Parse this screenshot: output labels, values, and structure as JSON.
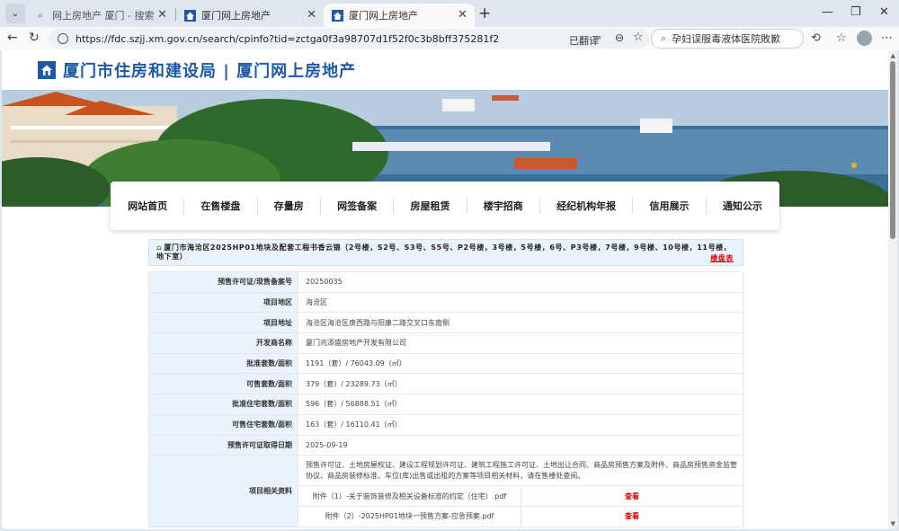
{
  "browser": {
    "tabs": [
      {
        "title": "网上房地产 厦门 - 搜索",
        "active": false
      },
      {
        "title": "厦门网上房地产",
        "active": false
      },
      {
        "title": "厦门网上房地产",
        "active": true
      }
    ],
    "url": "https://fdc.szjj.xm.gov.cn/search/cpinfo?tid=zctga0f3a98707d1f52f0c3b8bff375281f2",
    "translate_label": "已翻译",
    "search_query": "孕妇误服毒液体医院敗歉"
  },
  "site": {
    "title": "厦门市住房和建设局 | 厦门网上房地产",
    "accent": "#1c5aa6"
  },
  "nav": [
    "网站首页",
    "在售楼盘",
    "存量房",
    "网签备案",
    "房屋租赁",
    "楼宇招商",
    "经纪机构年报",
    "信用展示",
    "通知公示"
  ],
  "project": {
    "title": "厦门市海沧区2025HP01地块及配套工程书香云锦（2号楼，S2号、S3号、S5号、P2号楼，3号楼，5号楼，6号、P3号楼，7号楼，9号楼、10号楼，11号楼，地下室）",
    "link_label": "楼盘表"
  },
  "info_rows": [
    {
      "label": "预售许可证/现售备案号",
      "value": "20250035"
    },
    {
      "label": "项目地区",
      "value": "海沧区"
    },
    {
      "label": "项目地址",
      "value": "海沧区海沧区庚西路与阳康二路交叉口东南侧"
    },
    {
      "label": "开发商名称",
      "value": "厦门兆添盛房地产开发有限公司"
    },
    {
      "label": "批准套数/面积",
      "value": "1191（套）/ 76043.09（㎡）"
    },
    {
      "label": "可售套数/面积",
      "value": "379（套）/ 23289.73（㎡）"
    },
    {
      "label": "批准住宅套数/面积",
      "value": "596（套）/ 56888.51（㎡）"
    },
    {
      "label": "可售住宅套数/面积",
      "value": "163（套）/ 16110.41（㎡）"
    },
    {
      "label": "预售许可证取得日期",
      "value": "2025-09-19"
    }
  ],
  "materials": {
    "label": "项目相关资料",
    "desc": "预售许可证、土地房屋权证、建设工程规划许可证、建筑工程施工许可证、土地出让合同、商品房预售方案及附件、商品房预售资金监管协议、商品房装修标准、车位(库)出售或出租的方案等项目相关材料，请在售楼处查阅。",
    "attachments": [
      {
        "name": "附件（1）-关于装饰装修及相关设备标准的约定（住宅）.pdf",
        "action": "查看"
      },
      {
        "name": "附件（2）-2025HP01地块一预售方案-应急预案.pdf",
        "action": "查看"
      }
    ]
  }
}
